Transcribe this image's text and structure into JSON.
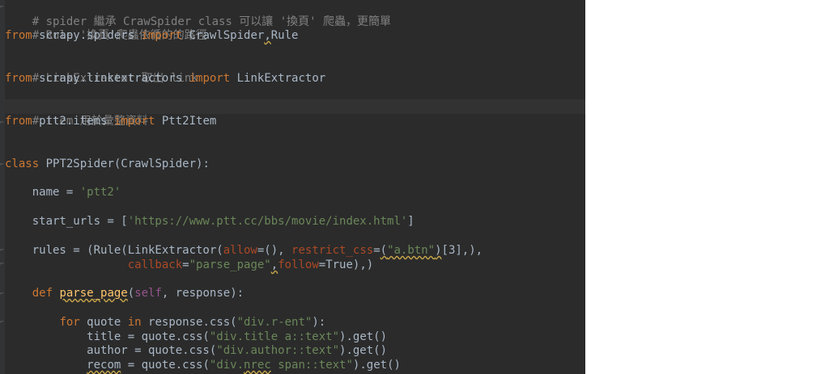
{
  "editor": {
    "language": "python",
    "colors": {
      "background": "#2b2b2b",
      "comment": "#808080",
      "keyword": "#cc7832",
      "string": "#6a8759",
      "keyword_argument": "#aa4926",
      "self": "#94558d",
      "function_name": "#ffc66d",
      "default_text": "#a9b7c6",
      "current_line": "#323232"
    },
    "lines": {
      "l1": "# spider 繼承 CrawSpider class 可以讓 '換頁' 爬蟲，更簡單",
      "l2": "# Rule '換頁'爬蟲依循的的路徑",
      "l3": {
        "t1": "from",
        "t2": " scrapy.spiders ",
        "t3": "import",
        "t4": " CrawlSpider",
        "t5": ",",
        "t6": "Rule"
      },
      "l5": "# LinkExtractor 取出 link",
      "l6": {
        "t1": "from",
        "t2": " scrapy.linkextractors ",
        "t3": "import",
        "t4": " LinkExtractor"
      },
      "l8": "# item 用於彙整資料",
      "l9": {
        "t1": "from",
        "t2": " ptt2.items ",
        "t3": "import",
        "t4": " Ptt2Item"
      },
      "l12": {
        "t1": "class",
        "t2": " PPT2Spider(CrawlSpider):"
      },
      "l14": {
        "t1": "    name = ",
        "t2": "'ptt2'"
      },
      "l16": {
        "t1": "    start_urls = [",
        "t2": "'https://www.ptt.cc/bbs/movie/index.html'",
        "t3": "]"
      },
      "l18": {
        "t1": "    rules = (Rule(LinkExtractor(",
        "t2": "allow",
        "t3": "=(), ",
        "t4": "restrict_css",
        "t5": "=",
        "t6": "(",
        "t7": "\"a.btn\"",
        "t8": ")",
        "t9": "[3],),"
      },
      "l19": {
        "t1": "                  ",
        "t2": "callback",
        "t3": "=",
        "t4": "\"parse_page\"",
        "t5": ",",
        "t6": "follow",
        "t7": "=True),)"
      },
      "l21": {
        "t1": "    ",
        "t2": "def",
        "t3": " ",
        "t4": "parse_page",
        "t5": "(",
        "t6": "self",
        "t7": ", response):"
      },
      "l23": {
        "t1": "        ",
        "t2": "for",
        "t3": " quote ",
        "t4": "in",
        "t5": " response.css(",
        "t6": "\"div.r-ent\"",
        "t7": "):"
      },
      "l24": {
        "t1": "            title = quote.css(",
        "t2": "\"div.title a::text\"",
        "t3": ").get()"
      },
      "l25": {
        "t1": "            author = quote.css(",
        "t2": "\"div.author::text\"",
        "t3": ").get()"
      },
      "l26": {
        "t1": "            ",
        "t2": "recom",
        "t3": " = quote.css(",
        "t4": "\"div.",
        "t5": "nrec",
        "t6": " span::text\"",
        "t7": ").get()"
      }
    }
  }
}
